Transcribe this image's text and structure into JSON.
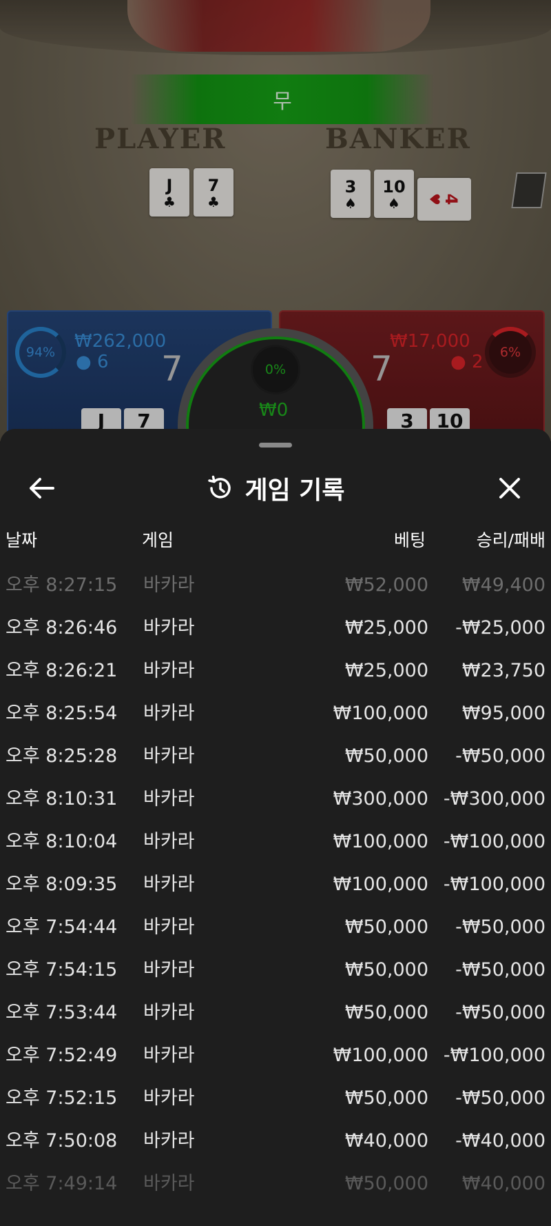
{
  "game_view": {
    "result_label": "무",
    "player_label": "PLAYER",
    "banker_label": "BANKER",
    "player_cards": [
      {
        "rank": "J",
        "suit": "♣",
        "color": "black"
      },
      {
        "rank": "7",
        "suit": "♣",
        "color": "black"
      }
    ],
    "banker_cards": [
      {
        "rank": "3",
        "suit": "♠",
        "color": "black"
      },
      {
        "rank": "10",
        "suit": "♠",
        "color": "black"
      },
      {
        "rank": "4",
        "suit": "♥",
        "color": "red"
      }
    ],
    "player_bet": {
      "percent": "94%",
      "amount": "₩262,000",
      "count": "6",
      "score": "7",
      "mini_cards": [
        "J",
        "7"
      ]
    },
    "banker_bet": {
      "percent": "6%",
      "amount": "₩17,000",
      "count": "2",
      "score": "7",
      "mini_cards": [
        "3",
        "10"
      ]
    },
    "tie_bet": {
      "percent": "0%",
      "amount": "₩0"
    },
    "colors": {
      "player": "#2a86d0",
      "banker": "#e0242a",
      "tie": "#17a617"
    }
  },
  "history": {
    "title": "게임 기록",
    "icons": {
      "back": "arrow-left-icon",
      "history": "history-icon",
      "close": "close-icon"
    },
    "columns": {
      "date": "날짜",
      "game": "게임",
      "bet": "베팅",
      "result": "승리/패배"
    },
    "rows": [
      {
        "date": "오후 8:27:15",
        "game": "바카라",
        "bet": "₩52,000",
        "result": "₩49,400"
      },
      {
        "date": "오후 8:26:46",
        "game": "바카라",
        "bet": "₩25,000",
        "result": "-₩25,000"
      },
      {
        "date": "오후 8:26:21",
        "game": "바카라",
        "bet": "₩25,000",
        "result": "₩23,750"
      },
      {
        "date": "오후 8:25:54",
        "game": "바카라",
        "bet": "₩100,000",
        "result": "₩95,000"
      },
      {
        "date": "오후 8:25:28",
        "game": "바카라",
        "bet": "₩50,000",
        "result": "-₩50,000"
      },
      {
        "date": "오후 8:10:31",
        "game": "바카라",
        "bet": "₩300,000",
        "result": "-₩300,000"
      },
      {
        "date": "오후 8:10:04",
        "game": "바카라",
        "bet": "₩100,000",
        "result": "-₩100,000"
      },
      {
        "date": "오후 8:09:35",
        "game": "바카라",
        "bet": "₩100,000",
        "result": "-₩100,000"
      },
      {
        "date": "오후 7:54:44",
        "game": "바카라",
        "bet": "₩50,000",
        "result": "-₩50,000"
      },
      {
        "date": "오후 7:54:15",
        "game": "바카라",
        "bet": "₩50,000",
        "result": "-₩50,000"
      },
      {
        "date": "오후 7:53:44",
        "game": "바카라",
        "bet": "₩50,000",
        "result": "-₩50,000"
      },
      {
        "date": "오후 7:52:49",
        "game": "바카라",
        "bet": "₩100,000",
        "result": "-₩100,000"
      },
      {
        "date": "오후 7:52:15",
        "game": "바카라",
        "bet": "₩50,000",
        "result": "-₩50,000"
      },
      {
        "date": "오후 7:50:08",
        "game": "바카라",
        "bet": "₩40,000",
        "result": "-₩40,000"
      },
      {
        "date": "오후 7:49:14",
        "game": "바카라",
        "bet": "₩50,000",
        "result": "₩40,000"
      }
    ]
  }
}
